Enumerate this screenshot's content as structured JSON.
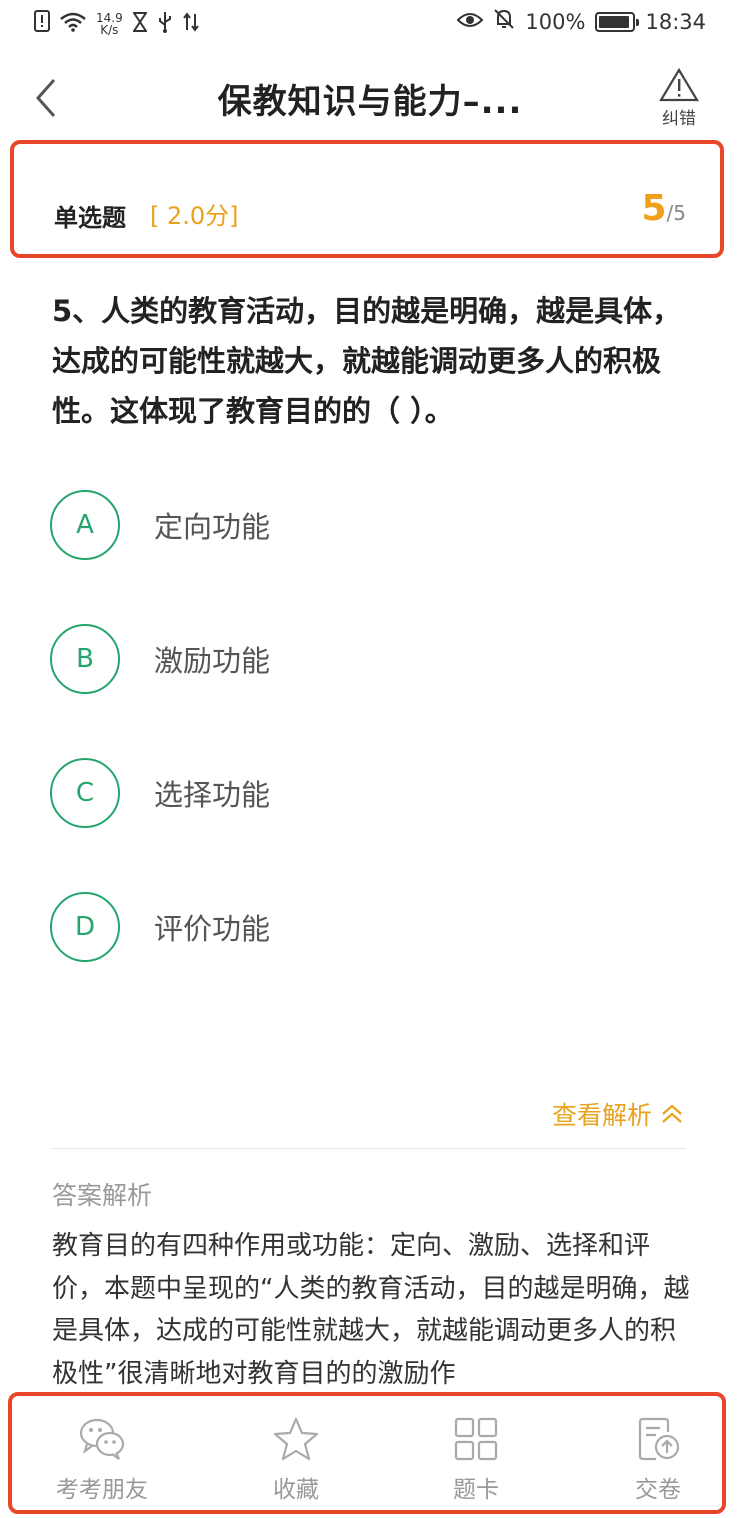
{
  "status_bar": {
    "net_speed_value": "14.9",
    "net_speed_unit": "K/s",
    "battery": "100%",
    "time": "18:34"
  },
  "header": {
    "title": "保教知识与能力–...",
    "report_label": "纠错"
  },
  "question_meta": {
    "type": "单选题",
    "score": "[ 2.0分]",
    "current": "5",
    "total": "/5"
  },
  "question": {
    "text": "5、人类的教育活动，目的越是明确，越是具体，达成的可能性就越大，就越能调动更多人的积极性。这体现了教育目的的（ ）。"
  },
  "options": [
    {
      "letter": "A",
      "text": "定向功能"
    },
    {
      "letter": "B",
      "text": "激励功能"
    },
    {
      "letter": "C",
      "text": "选择功能"
    },
    {
      "letter": "D",
      "text": "评价功能"
    }
  ],
  "analysis": {
    "toggle_label": "查看解析",
    "label": "答案解析",
    "text": "教育目的有四种作用或功能：定向、激励、选择和评价，本题中呈现的“人类的教育活动，目的越是明确，越是具体，达成的可能性就越大，就越能调动更多人的积极性”很清晰地对教育目的的激励作"
  },
  "bottom_tabs": [
    {
      "label": "考考朋友",
      "icon": "wechat-icon"
    },
    {
      "label": "收藏",
      "icon": "star-icon"
    },
    {
      "label": "题卡",
      "icon": "grid-icon"
    },
    {
      "label": "交卷",
      "icon": "submit-icon"
    }
  ],
  "colors": {
    "accent_green": "#25a56b",
    "accent_orange": "#e9a21c",
    "highlight_red": "#e8462a"
  }
}
